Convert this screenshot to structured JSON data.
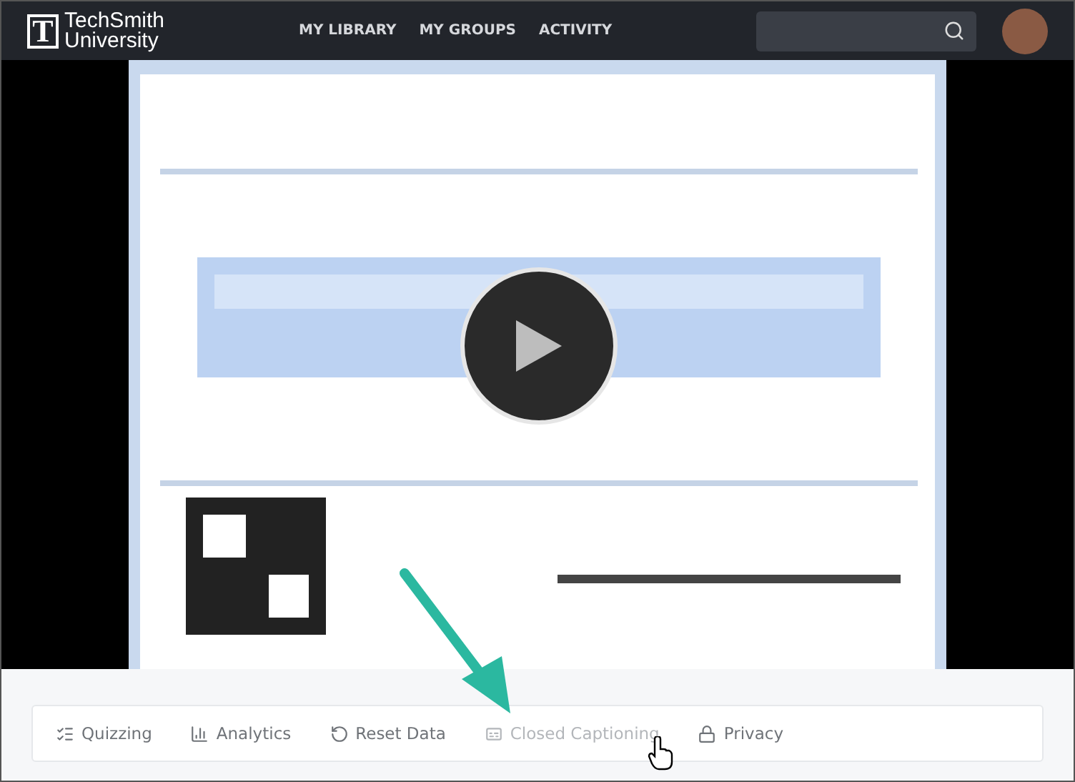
{
  "header": {
    "logo_mark": "T",
    "logo_lines": [
      "TechSmith",
      "University"
    ],
    "nav": [
      {
        "label": "MY LIBRARY"
      },
      {
        "label": "MY GROUPS"
      },
      {
        "label": "ACTIVITY"
      }
    ]
  },
  "toolbar": [
    {
      "kind": "quiz",
      "label": "Quizzing",
      "hovered": false
    },
    {
      "kind": "analytics",
      "label": "Analytics",
      "hovered": false
    },
    {
      "kind": "reset",
      "label": "Reset Data",
      "hovered": false
    },
    {
      "kind": "cc",
      "label": "Closed Captioning",
      "hovered": true
    },
    {
      "kind": "privacy",
      "label": "Privacy",
      "hovered": false
    }
  ]
}
